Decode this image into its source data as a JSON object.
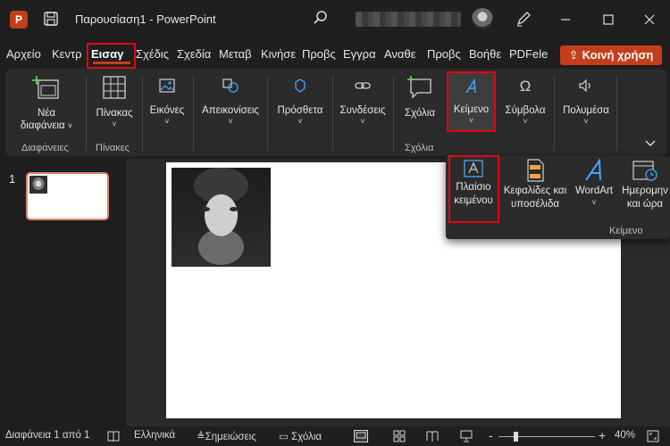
{
  "titlebar": {
    "app_logo": "P",
    "doc_title": "Παρουσίαση1 - PowerPoint",
    "icons": [
      "save-icon",
      "search-icon",
      "pen-icon",
      "minimize-icon",
      "maximize-icon",
      "close-icon"
    ]
  },
  "menu": {
    "tabs": [
      "Αρχείο",
      "Κεντρ",
      "Εισαγ",
      "Σχέδις",
      "Σχεδία",
      "Μεταβ",
      "Κινήσε",
      "Προβς",
      "Εγγρα",
      "Αναθε",
      "Προβς",
      "Βοήθε",
      "PDFele"
    ],
    "active_index": 2,
    "share_label": "Κοινή χρήση"
  },
  "ribbon": {
    "new_slide": {
      "line1": "Νέα",
      "line2": "διαφάνεια"
    },
    "group_slides": "Διαφάνειες",
    "table": "Πίνακας",
    "group_tables": "Πίνακες",
    "images": "Εικόνες",
    "illustrations": "Απεικονίσεις",
    "addins": "Πρόσθετα",
    "links": "Συνδέσεις",
    "comment": "Σχόλια",
    "group_comments": "Σχόλια",
    "text": "Κείμενο",
    "symbols": "Σύμβολα",
    "media": "Πολυμέσα",
    "chevron": "˅"
  },
  "text_dropdown": {
    "textbox": {
      "line1": "Πλαίσιο",
      "line2": "κειμένου"
    },
    "header_footer": {
      "line1": "Κεφαλίδες και",
      "line2": "υποσέλιδα"
    },
    "wordart": "WordArt",
    "datetime": {
      "line1": "Ημερομην",
      "line2": "και ώρα"
    },
    "group_label": "Κείμενο"
  },
  "slides_pane": {
    "slide_number": "1"
  },
  "statusbar": {
    "slide_info": "Διαφάνεια 1 από 1",
    "language": "Ελληνικά",
    "notes": "Σημειώσεις",
    "comments": "Σχόλια",
    "zoom_minus": "-",
    "zoom_plus": "+",
    "zoom": "40%"
  },
  "colors": {
    "accent": "#c43e1c",
    "highlight": "#e30613",
    "icon_blue": "#4aa3ff"
  }
}
